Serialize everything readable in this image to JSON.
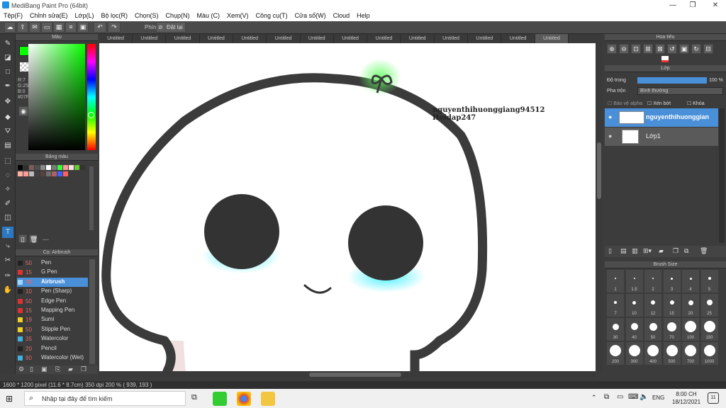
{
  "window": {
    "title": "MediBang Paint Pro (64bit)",
    "min": "—",
    "max": "❐",
    "close": "✕"
  },
  "menu": [
    "Tệp(F)",
    "Chỉnh sửa(E)",
    "Lớp(L)",
    "Bộ lọc(R)",
    "Chọn(S)",
    "Chụp(N)",
    "Màu (C)",
    "Xem(V)",
    "Công cụ(T)",
    "Cửa sổ(W)",
    "Cloud",
    "Help"
  ],
  "toolbar": {
    "phim_label": "Phím",
    "reset_label": "Đặt lại"
  },
  "color_panel": {
    "title": "Màu",
    "r": "R:7",
    "g": "G:255",
    "b": "B:0",
    "hex": "#07FF00",
    "fg_color": "#07ff00"
  },
  "swatch_panel": {
    "title": "Bảng màu",
    "more": "---",
    "swatches": [
      "#000000",
      "#303030",
      "#7a5c5c",
      "#505050",
      "#8a8a8a",
      "#ffffff",
      "#7a7a7a",
      "#3aff3a",
      "#ff9999",
      "#ffe0e0",
      "#66cc33",
      "#333333",
      "#ffb0a0",
      "#ff9a9a",
      "#bbbbbb",
      "#404040",
      "#5a4040",
      "#707070",
      "#b06060",
      "#4060ff",
      "#ff6060"
    ]
  },
  "brush_panel": {
    "title": "Cọ: Airbrush",
    "items": [
      {
        "num": "50",
        "label": "Pen",
        "color": "#222222"
      },
      {
        "num": "15",
        "label": "G Pen",
        "color": "#e03030"
      },
      {
        "num": "70",
        "label": "Airbrush",
        "color": "#9fd8ff"
      },
      {
        "num": "10",
        "label": "Pen (Sharp)",
        "color": "#222222"
      },
      {
        "num": "50",
        "label": "Edge Pen",
        "color": "#e03030"
      },
      {
        "num": "15",
        "label": "Mapping Pen",
        "color": "#e03030"
      },
      {
        "num": "19",
        "label": "Sumi",
        "color": "#f0d020"
      },
      {
        "num": "50",
        "label": "Stipple Pen",
        "color": "#f0d020"
      },
      {
        "num": "35",
        "label": "Watercolor",
        "color": "#40b0e0"
      },
      {
        "num": "20",
        "label": "Pencil",
        "color": "#222222"
      },
      {
        "num": "90",
        "label": "Watercolor (Wet)",
        "color": "#40b0e0"
      }
    ]
  },
  "tabs": [
    "Untitled",
    "Untitled",
    "Untitled",
    "Untitled",
    "Untitled",
    "Untitled",
    "Untitled",
    "Untitled",
    "Untitled",
    "Untitled",
    "Untitled",
    "Untitled",
    "Untitled",
    "Untitled"
  ],
  "canvas": {
    "watermark_line1": "nguyenthihuonggiang94512",
    "watermark_line2": "Hoidap247"
  },
  "nav_panel": {
    "title": "Hoa tiêu"
  },
  "layer_panel": {
    "title": "Lớp",
    "opacity_label": "Độ trong",
    "opacity_value": "100 %",
    "opacity": 1.0,
    "blend_label": "Pha trộn",
    "blend_value": "Bình thường",
    "protect_alpha": "Bảo vệ alpha",
    "clipping": "Xén bớt",
    "lock": "Khóa",
    "layers": [
      {
        "name": "nguyenthihuonggian",
        "selected": true
      },
      {
        "name": "Lớp1",
        "selected": false
      }
    ]
  },
  "brush_size_panel": {
    "title": "Brush Size",
    "sizes": [
      "1",
      "1.5",
      "2",
      "3",
      "4",
      "5",
      "7",
      "10",
      "12",
      "15",
      "20",
      "25",
      "30",
      "40",
      "50",
      "70",
      "100",
      "150",
      "200",
      "300",
      "400",
      "500",
      "700",
      "1000"
    ]
  },
  "status": {
    "dimensions": "1600 * 1200 pixel",
    "physical": "(11.6 * 8.7cm)",
    "dpi": "350 dpi",
    "zoom": "200 %",
    "coords": "( 939, 193 )"
  },
  "taskbar": {
    "search_placeholder": "Nhập tại đây để tìm kiếm",
    "lang": "ENG",
    "time": "8:00 CH",
    "date": "18/12/2021",
    "notif": "11"
  }
}
